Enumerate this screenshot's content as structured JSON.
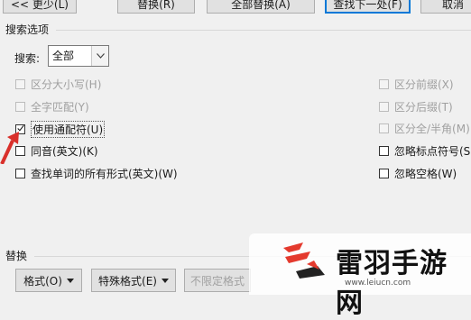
{
  "top_buttons": {
    "less": "<< 更少(L)",
    "replace": "替换(R)",
    "replace_all": "全部替换(A)",
    "find_next": "查找下一处(F)",
    "cancel": "取消"
  },
  "search_options": {
    "title": "搜索选项",
    "search_label": "搜索:",
    "search_value": "全部"
  },
  "left_options": [
    {
      "label": "区分大小写(H)",
      "checked": false,
      "disabled": true
    },
    {
      "label": "全字匹配(Y)",
      "checked": false,
      "disabled": true
    },
    {
      "label": "使用通配符(U)",
      "checked": true,
      "disabled": false
    },
    {
      "label": "同音(英文)(K)",
      "checked": false,
      "disabled": false
    },
    {
      "label": "查找单词的所有形式(英文)(W)",
      "checked": false,
      "disabled": false
    }
  ],
  "right_options": [
    {
      "label": "区分前缀(X)",
      "checked": false,
      "disabled": true
    },
    {
      "label": "区分后缀(T)",
      "checked": false,
      "disabled": true
    },
    {
      "label": "区分全/半角(M)",
      "checked": false,
      "disabled": true
    },
    {
      "label": "忽略标点符号(S)",
      "checked": false,
      "disabled": false
    },
    {
      "label": "忽略空格(W)",
      "checked": false,
      "disabled": false
    }
  ],
  "replace_section": {
    "title": "替换",
    "format_button": "格式(O)",
    "special_format_button": "特殊格式(E)",
    "no_format_button": "不限定格式"
  },
  "watermark": {
    "brand": "雷羽手游网",
    "url": "www.leiucn.com"
  },
  "colors": {
    "accent": "#0078d7",
    "arrow": "#d9302b",
    "watermark_red": "#e43a2e",
    "watermark_dark": "#222222"
  }
}
